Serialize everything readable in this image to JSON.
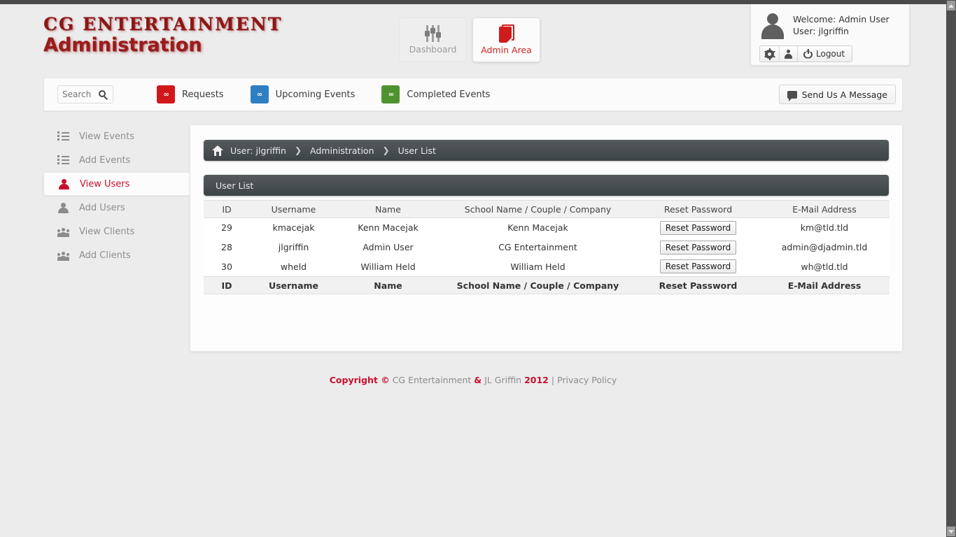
{
  "brand": {
    "logo_line1": "CG ENTERTAINMENT",
    "logo_line2": "Administration",
    "accent_red": "#c8102e",
    "logo_red": "#8e1616"
  },
  "nav_tabs": [
    {
      "label": "Dashboard",
      "icon": "sliders-icon",
      "active": false
    },
    {
      "label": "Admin Area",
      "icon": "page-icon",
      "active": true
    }
  ],
  "user_panel": {
    "avatar_icon": "avatar-icon",
    "welcome_line": "Welcome: Admin User",
    "user_line": "User: jlgriffin",
    "buttons": [
      {
        "label": "",
        "icon": "gear-icon"
      },
      {
        "label": "",
        "icon": "person-icon"
      },
      {
        "label": "Logout",
        "icon": "power-icon"
      }
    ]
  },
  "toolbar": {
    "search_placeholder": "Search",
    "search_value": "",
    "search_icon": "search-icon",
    "stats": [
      {
        "label": "Requests",
        "count": "∞",
        "color": "#d0181a"
      },
      {
        "label": "Upcoming Events",
        "count": "∞",
        "color": "#2e7fc1"
      },
      {
        "label": "Completed Events",
        "count": "∞",
        "color": "#4f9330"
      }
    ],
    "message_button": "Send Us A Message",
    "message_icon": "speech-bubble-icon"
  },
  "sidebar": {
    "items": [
      {
        "label": "View Events",
        "icon": "list-icon",
        "active": false
      },
      {
        "label": "Add Events",
        "icon": "list-icon",
        "active": false
      },
      {
        "label": "View Users",
        "icon": "person-icon",
        "active": true
      },
      {
        "label": "Add Users",
        "icon": "person-icon",
        "active": false
      },
      {
        "label": "View Clients",
        "icon": "group-icon",
        "active": false
      },
      {
        "label": "Add Clients",
        "icon": "group-icon",
        "active": false
      }
    ]
  },
  "breadcrumb": {
    "home_icon": "home-icon",
    "items": [
      "User: jlgriffin",
      "Administration",
      "User List"
    ],
    "separator": "❯"
  },
  "panel": {
    "title": "User List",
    "table": {
      "columns": [
        "ID",
        "Username",
        "Name",
        "School Name / Couple / Company",
        "Reset Password",
        "E-Mail Address"
      ],
      "rows": [
        {
          "id": "29",
          "username": "kmacejak",
          "name": "Kenn Macejak",
          "school": "Kenn Macejak",
          "reset_label": "Reset Password",
          "email": "km@tld.tld"
        },
        {
          "id": "28",
          "username": "jlgriffin",
          "name": "Admin User",
          "school": "CG Entertainment",
          "reset_label": "Reset Password",
          "email": "admin@djadmin.tld"
        },
        {
          "id": "30",
          "username": "wheld",
          "name": "William Held",
          "school": "William Held",
          "reset_label": "Reset Password",
          "email": "wh@tld.tld"
        }
      ]
    }
  },
  "footer": {
    "copyright_label": "Copyright ©",
    "company": "CG Entertainment",
    "amp": "&",
    "author": "JL Griffin",
    "year": "2012",
    "divider": "|",
    "privacy": "Privacy Policy"
  }
}
